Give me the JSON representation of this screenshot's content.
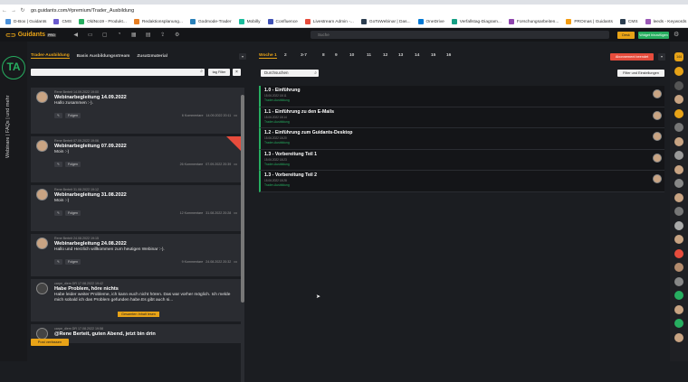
{
  "browser": {
    "url": "go.guidants.com/#premium/Trader_Ausbildung",
    "bookmarks": [
      "D-Box | Guidants",
      "CMS",
      "OldNo19 - Produkt...",
      "Redaktionsplanung...",
      "Godmode-Trader",
      "Mobilly",
      "Confluence",
      "Livestream Admin -...",
      "GoToWebinar | Das...",
      "OneDrive",
      "Verfallstag-Diagram...",
      "Forschungsarbeiten...",
      "PROmas | Guidants",
      "CMS",
      "leeds - Keywords Ex...",
      "GMX freeday"
    ]
  },
  "app": {
    "logo": "Guidants",
    "logo_badge": "PRO",
    "search_placeholder": "Suche",
    "btn_yellow": "Desk",
    "btn_green": "Widget hinzufügen",
    "icons": [
      "back-icon",
      "monitor-icon",
      "chat-icon",
      "bell-icon",
      "grid-icon",
      "chart-icon",
      "upload-icon",
      "settings-icon"
    ]
  },
  "rail": {
    "badge": "TA",
    "vertical_text": "Webinare | FAQs | und mehr"
  },
  "left": {
    "tabs": [
      "Trader-Ausbildung",
      "Basis Ausbildungsstream",
      "Zusatzmaterial"
    ],
    "tag_filter": "tag Filter",
    "close": "×",
    "post_button": "Post verfassen",
    "posts": [
      {
        "meta": "Rene Berteit 14.09.2022 19:00",
        "title": "Webinarbegleitung 14.09.2022",
        "body": "Hallo zusammen :-).",
        "badge": "",
        "comments": "6 Kommentare",
        "cdate": "14.09.2022 20:11"
      },
      {
        "meta": "Rene Berteit 07.09.2022 19:06",
        "title": "Webinarbegleitung 07.09.2022",
        "body": "Moin :-)",
        "badge": "",
        "comments": "26 Kommentare",
        "cdate": "07.09.2022 20:39"
      },
      {
        "meta": "Rene Berteit 31.08.2022 19:12",
        "title": "Webinarbegleitung 31.08.2022",
        "body": "Moin :-)",
        "badge": "",
        "comments": "12 Kommentare",
        "cdate": "31.08.2022 20:28"
      },
      {
        "meta": "Rene Berteit 24.08.2022 19:15",
        "title": "Webinarbegleitung 24.08.2022",
        "body": "Hallo und Herzlich willkommen zum heutigen Webinar :-).",
        "badge": "",
        "comments": "9 Kommentare",
        "cdate": "24.08.2022 20:32"
      },
      {
        "meta": "carpe_diem DR 17.08.2022 19:42",
        "title": "Habe Problem, höre nichts",
        "body": "Habe leider weiter Probleme, ich kann euch nicht hören. Das war vorher möglich. Ich melde mich sobald ich das Problem gefunden habe.Es gibt auch si...",
        "badge": "Gesamten Inhalt lesen",
        "comments": "Kommentieren",
        "cdate": ""
      },
      {
        "meta": "carpe_diem DR 17.08.2022 19:58",
        "title": "@Rene Berteit, guten Abend, jetzt bin drin",
        "body": "",
        "badge": "",
        "comments": "",
        "cdate": ""
      }
    ],
    "post_buttons": [
      "Folgen"
    ]
  },
  "right": {
    "weeks": [
      "Woche 1",
      "2",
      "3-7",
      "8",
      "9",
      "10",
      "11",
      "12",
      "13",
      "14",
      "15",
      "16"
    ],
    "red_button": "Abonnement beendet",
    "search_value": "Durchsuchen",
    "filter_button": "Filter und Einstellungen",
    "items": [
      {
        "title": "1.0 - Einführung",
        "date": "15.06.2022 18:11",
        "tag": "Trader-Ausbildung"
      },
      {
        "title": "1.1 - Einführung zu den E-Mails",
        "date": "15.06.2022 18:14",
        "tag": "Trader-Ausbildung"
      },
      {
        "title": "1.2 - Einführung zum Guidants-Desktop",
        "date": "15.06.2022 18:20",
        "tag": "Trader-Ausbildung"
      },
      {
        "title": "1.3 - Vorbereitung Teil 1",
        "date": "15.06.2022 18:23",
        "tag": "Trader-Ausbildung"
      },
      {
        "title": "1.3 - Vorbereitung Teil 2",
        "date": "15.06.2022 18:28",
        "tag": "Trader-Ausbildung"
      }
    ]
  },
  "sidebar": {
    "badge": "144",
    "colors": [
      "#e8a317",
      "#555",
      "#c9a483",
      "#e8a317",
      "#777",
      "#c9a483",
      "#999",
      "#c9a483",
      "#888",
      "#c9a483",
      "#777",
      "#aaa",
      "#c9a483",
      "#e74c3c",
      "#b38b6d",
      "#888",
      "#27ae60",
      "#c9a483",
      "#27ae60",
      "#c9a483"
    ]
  }
}
